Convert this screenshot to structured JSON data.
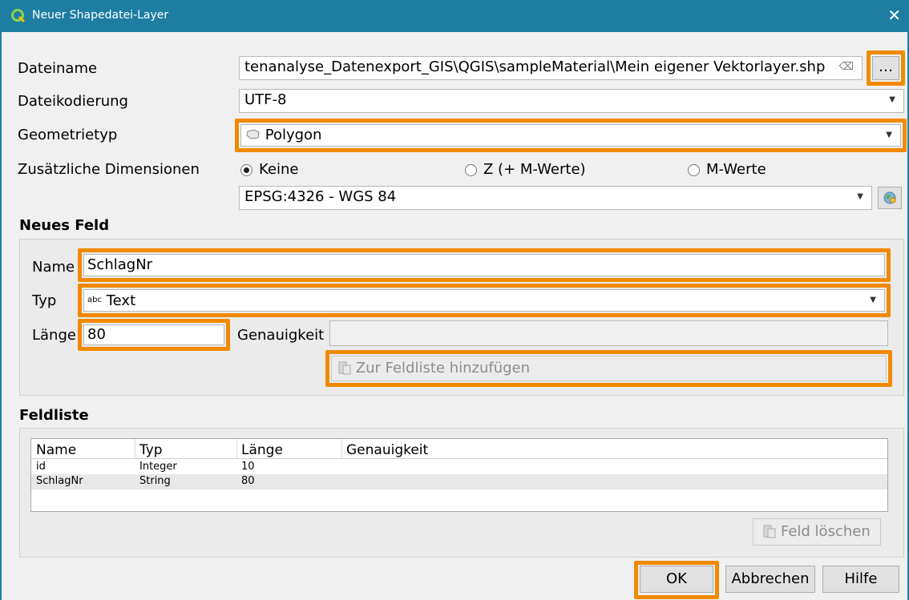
{
  "window": {
    "title": "Neuer Shapedatei-Layer",
    "close": "✕"
  },
  "form": {
    "dateiname_label": "Dateiname",
    "dateiname_value": "tenanalyse_Datenexport_GIS\\QGIS\\sampleMaterial\\Mein eigener Vektorlayer.shp",
    "browse_label": "…",
    "encoding_label": "Dateikodierung",
    "encoding_value": "UTF-8",
    "geom_label": "Geometrietyp",
    "geom_value": "Polygon",
    "dims_label": "Zusätzliche Dimensionen",
    "dims_options": [
      "Keine",
      "Z (+ M-Werte)",
      "M-Werte"
    ],
    "crs_value": "EPSG:4326 - WGS 84"
  },
  "neues_feld": {
    "heading": "Neues Feld",
    "name_label": "Name",
    "name_value": "SchlagNr",
    "typ_label": "Typ",
    "typ_icon": "abc",
    "typ_value": "Text",
    "laenge_label": "Länge",
    "laenge_value": "80",
    "genauigkeit_label": "Genauigkeit",
    "add_button": "Zur Feldliste hinzufügen"
  },
  "feldliste": {
    "heading": "Feldliste",
    "columns": [
      "Name",
      "Typ",
      "Länge",
      "Genauigkeit"
    ],
    "rows": [
      [
        "id",
        "Integer",
        "10",
        ""
      ],
      [
        "SchlagNr",
        "String",
        "80",
        ""
      ]
    ],
    "delete_button": "Feld löschen"
  },
  "buttons": {
    "ok": "OK",
    "cancel": "Abbrechen",
    "help": "Hilfe"
  },
  "colors": {
    "titlebar": "#1d7ea2",
    "highlight": "#f08a00",
    "alt_row": "#e8e8e8"
  }
}
